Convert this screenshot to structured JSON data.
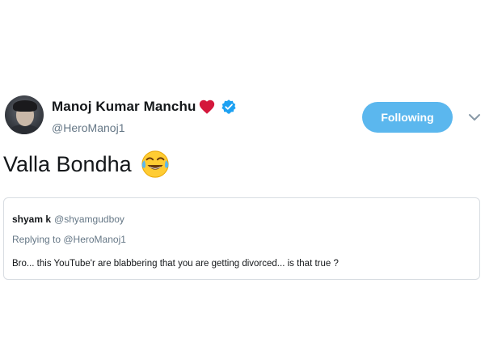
{
  "tweet": {
    "author": {
      "display_name": "Manoj Kumar Manchu",
      "handle": "@HeroManoj1",
      "avatar": "profile-photo",
      "name_icons": [
        "red-heart-icon",
        "verified-badge-icon"
      ]
    },
    "follow_button": {
      "label": "Following",
      "color": "#5bb7ee"
    },
    "menu_icon": "chevron-down-icon",
    "text": "Valla Bondha",
    "emoji": "face-with-tears-of-joy-icon",
    "quoted_tweet": {
      "author_name": "shyam k",
      "author_handle": "@shyamgudboy",
      "replying_to": "Replying to @HeroManoj1",
      "text": "Bro... this YouTube'r are blabbering that you are getting divorced... is that true ?"
    }
  },
  "colors": {
    "link_blue": "#1da1f2",
    "muted_gray": "#657786",
    "heart_red": "#e0245e"
  }
}
